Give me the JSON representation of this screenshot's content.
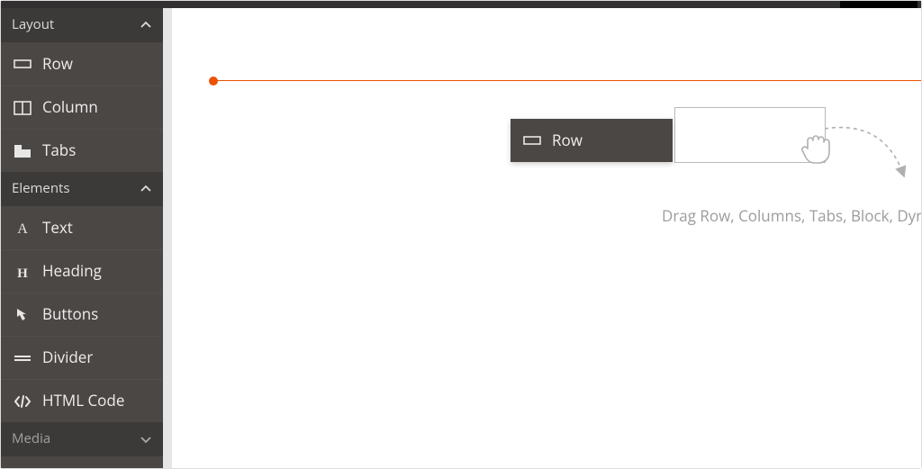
{
  "sidebar": {
    "groups": [
      {
        "label": "Layout",
        "expanded": true,
        "items": [
          {
            "label": "Row",
            "icon": "row-icon"
          },
          {
            "label": "Column",
            "icon": "column-icon"
          },
          {
            "label": "Tabs",
            "icon": "tabs-icon"
          }
        ]
      },
      {
        "label": "Elements",
        "expanded": true,
        "items": [
          {
            "label": "Text",
            "icon": "text-icon"
          },
          {
            "label": "Heading",
            "icon": "heading-icon"
          },
          {
            "label": "Buttons",
            "icon": "buttons-icon"
          },
          {
            "label": "Divider",
            "icon": "divider-icon"
          },
          {
            "label": "HTML Code",
            "icon": "html-code-icon"
          }
        ]
      },
      {
        "label": "Media",
        "expanded": false,
        "items": []
      }
    ]
  },
  "canvas": {
    "drag_tile_label": "Row",
    "hint": "Drag Row, Columns, Tabs, Block, Dyn"
  },
  "colors": {
    "accent": "#eb5202",
    "sidebar_bg": "#4a4745",
    "sidebar_header_bg": "#3c3a38"
  }
}
